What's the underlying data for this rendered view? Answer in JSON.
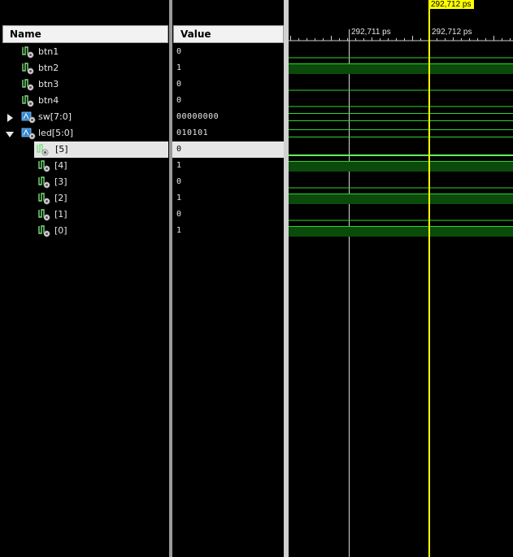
{
  "columns": {
    "name": "Name",
    "value": "Value"
  },
  "signals": [
    {
      "name": "btn1",
      "value": "0",
      "indent": 0,
      "kind": "bit",
      "expand": ""
    },
    {
      "name": "btn2",
      "value": "1",
      "indent": 0,
      "kind": "bit",
      "expand": ""
    },
    {
      "name": "btn3",
      "value": "0",
      "indent": 0,
      "kind": "bit",
      "expand": ""
    },
    {
      "name": "btn4",
      "value": "0",
      "indent": 0,
      "kind": "bit",
      "expand": ""
    },
    {
      "name": "sw[7:0]",
      "value": "00000000",
      "indent": 0,
      "kind": "bus",
      "expand": "collapsed"
    },
    {
      "name": "led[5:0]",
      "value": "010101",
      "indent": 0,
      "kind": "bus",
      "expand": "expanded"
    },
    {
      "name": "[5]",
      "value": "0",
      "indent": 1,
      "kind": "bit",
      "expand": "",
      "selected": true
    },
    {
      "name": "[4]",
      "value": "1",
      "indent": 1,
      "kind": "bit",
      "expand": ""
    },
    {
      "name": "[3]",
      "value": "0",
      "indent": 1,
      "kind": "bit",
      "expand": ""
    },
    {
      "name": "[2]",
      "value": "1",
      "indent": 1,
      "kind": "bit",
      "expand": ""
    },
    {
      "name": "[1]",
      "value": "0",
      "indent": 1,
      "kind": "bit",
      "expand": ""
    },
    {
      "name": "[0]",
      "value": "1",
      "indent": 1,
      "kind": "bit",
      "expand": ""
    }
  ],
  "waveform": {
    "time_markers": [
      "292,711 ps",
      "292,712 ps"
    ],
    "cursor_time": "292,712 ps",
    "colors": {
      "cursor": "#ffff00",
      "signal": "#2bd62b",
      "high_fill": "#0b4a0b",
      "selected": "#5cff5c",
      "marker_line": "#d8d8d8"
    }
  },
  "icons": {
    "bit": "signal-icon",
    "bus": "bus-icon",
    "collapsed": "expand-arrow-icon",
    "expanded": "collapse-arrow-icon"
  }
}
